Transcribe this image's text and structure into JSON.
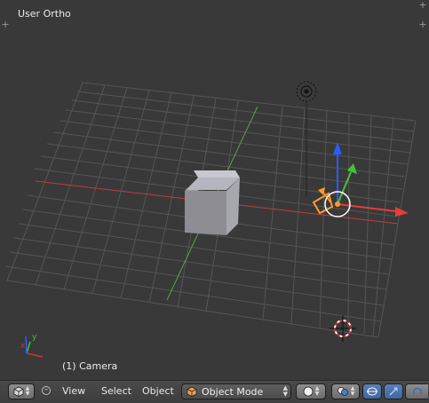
{
  "viewport": {
    "view_title": "User Ortho",
    "active_object_label": "(1) Camera",
    "axis_indicator": {
      "x_label": "x",
      "y_label": "y"
    }
  },
  "header": {
    "editor_type_icon": "cube-icon",
    "menu": {
      "view": "View",
      "select": "Select",
      "object": "Object"
    },
    "mode_select": {
      "value": "Object Mode",
      "icon": "cube-orange-icon"
    },
    "shading_icon": "sphere-icon",
    "pivot_icon": "pivot-icon",
    "manipulator_icons": [
      "transform-toggle-icon",
      "translate-arrow-icon",
      "rotate-icon"
    ]
  },
  "colors": {
    "viewport_bg": "#393939",
    "grid": "#555555",
    "x_axis": "#c23b3b",
    "y_axis": "#5aa04a",
    "z_axis": "#2b5cff",
    "selection": "#ff9a2a",
    "header_bg": "#444444"
  }
}
